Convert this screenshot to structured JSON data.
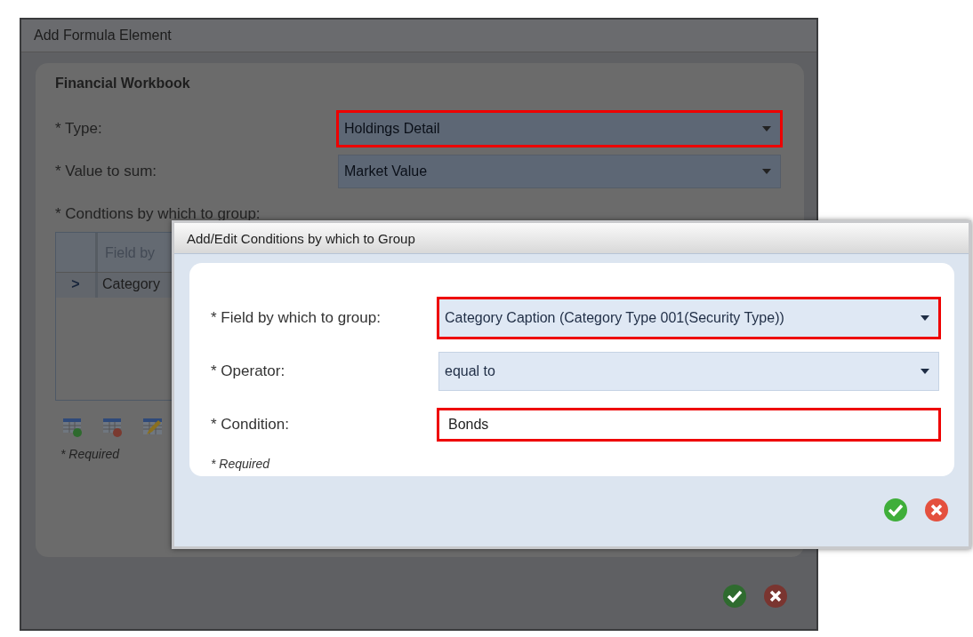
{
  "dialog": {
    "title": "Add Formula Element",
    "section_title": "Financial Workbook",
    "fields": [
      {
        "label": "* Type:",
        "value": "Holdings Detail",
        "kind": "select",
        "highlighted": true
      },
      {
        "label": "* Value to sum:",
        "value": "Market Value",
        "kind": "select",
        "highlighted": false
      }
    ],
    "conditions_label": "* Condtions by which to group:",
    "grid": {
      "columns": [
        "Field by"
      ],
      "rows": [
        {
          "marker": ">",
          "cells": [
            "Category"
          ]
        }
      ]
    },
    "required_note": "* Required"
  },
  "modal": {
    "title": "Add/Edit Conditions by which to Group",
    "fields": [
      {
        "label": "* Field by which to group:",
        "value": "Category Caption (Category Type 001(Security Type))",
        "kind": "select",
        "highlighted": true
      },
      {
        "label": "* Operator:",
        "value": "equal to",
        "kind": "select",
        "highlighted": false
      },
      {
        "label": "* Condition:",
        "value": "Bonds",
        "kind": "text",
        "highlighted": true
      }
    ],
    "required_note": "* Required"
  }
}
